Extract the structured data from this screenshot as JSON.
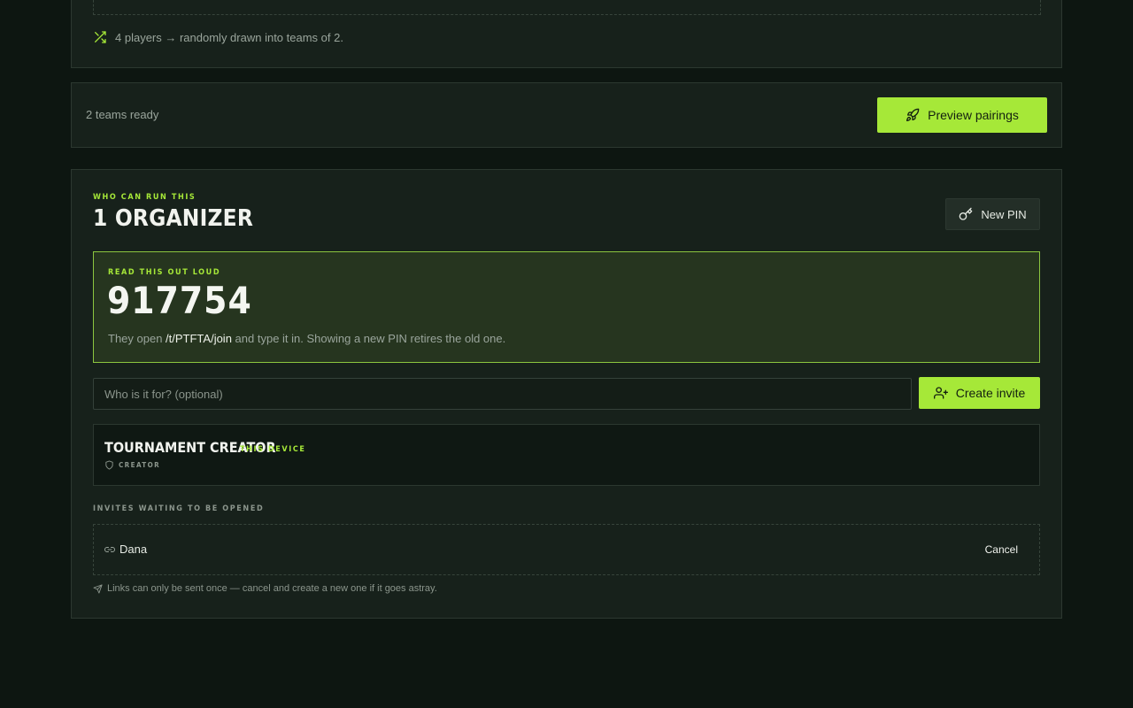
{
  "draw": {
    "text": "4 players → randomly drawn into teams of 2."
  },
  "ready": {
    "status": "2 teams ready",
    "preview_label": "Preview pairings"
  },
  "organizers": {
    "eyebrow": "Who can run this",
    "title": "1 organizer",
    "new_pin_label": "New PIN",
    "pin": {
      "eyebrow": "Read this out loud",
      "code": "917754",
      "note_before": "They open ",
      "note_path": "/t/PTFTA/join",
      "note_after": " and type it in. Showing a new PIN retires the old one."
    },
    "invite": {
      "placeholder": "Who is it for? (optional)",
      "button_label": "Create invite"
    },
    "creator": {
      "name": "Tournament Creator",
      "device_tag": "This device",
      "role": "Creator"
    },
    "waiting": {
      "label": "Invites waiting to be opened",
      "items": [
        {
          "name": "Dana",
          "cancel_label": "Cancel"
        }
      ],
      "footnote": "Links can only be sent once — cancel and create a new one if it goes astray."
    }
  },
  "colors": {
    "accent": "#a6e838",
    "background": "#0d1611",
    "panel": "#17211b",
    "pin_box": "#26351f"
  },
  "icons": {
    "draw": "shuffle-icon",
    "preview": "rocket-icon",
    "new_pin": "key-icon",
    "invite": "user-plus-icon",
    "role": "shield-icon",
    "invite_item": "link-icon",
    "footnote": "send-icon"
  }
}
